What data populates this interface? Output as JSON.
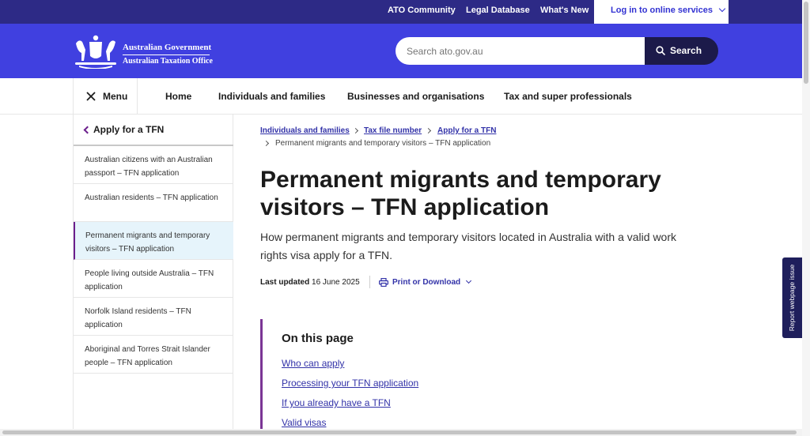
{
  "utility": {
    "links": [
      "ATO Community",
      "Legal Database",
      "What's New"
    ],
    "login": "Log in to online services"
  },
  "brand": {
    "gov": "Australian Government",
    "office": "Australian Taxation Office"
  },
  "search": {
    "placeholder": "Search ato.gov.au",
    "button": "Search"
  },
  "nav": {
    "menu": "Menu",
    "links": [
      "Home",
      "Individuals and families",
      "Businesses and organisations",
      "Tax and super professionals"
    ]
  },
  "sidebar": {
    "back": "Apply for a TFN",
    "items": [
      "Australian citizens with an Australian passport – TFN application",
      "Australian residents – TFN application",
      "Permanent migrants and temporary visitors – TFN application",
      "People living outside Australia – TFN application",
      "Norfolk Island residents – TFN application",
      "Aboriginal and Torres Strait Islander people – TFN application"
    ],
    "active_index": 2
  },
  "breadcrumb": {
    "links": [
      "Individuals and families",
      "Tax file number",
      "Apply for a TFN"
    ],
    "current": "Permanent migrants and temporary visitors – TFN application"
  },
  "page": {
    "title": "Permanent migrants and temporary visitors – TFN application",
    "lede": "How permanent migrants and temporary visitors located in Australia with a valid work rights visa apply for a TFN.",
    "updated_label": "Last updated",
    "updated_date": "16 June 2025",
    "print": "Print or Download"
  },
  "on_this_page": {
    "heading": "On this page",
    "links": [
      "Who can apply",
      "Processing your TFN application",
      "If you already have a TFN",
      "Valid visas"
    ]
  },
  "report": "Report webpage issue",
  "colors": {
    "utility_bar": "#2d2a86",
    "brand_bar": "#4040e0",
    "search_button": "#1c1a4a",
    "accent_purple": "#7b3595",
    "link_blue": "#3232a8"
  }
}
